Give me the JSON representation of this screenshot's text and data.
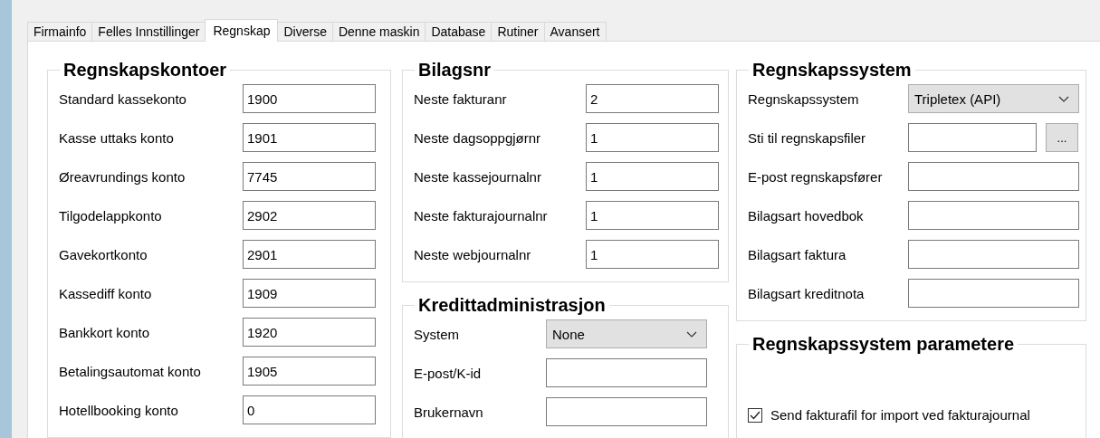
{
  "tabs": [
    {
      "label": "Firmainfo",
      "selected": false
    },
    {
      "label": "Felles Innstillinger",
      "selected": false
    },
    {
      "label": "Regnskap",
      "selected": true
    },
    {
      "label": "Diverse",
      "selected": false
    },
    {
      "label": "Denne maskin",
      "selected": false
    },
    {
      "label": "Database",
      "selected": false
    },
    {
      "label": "Rutiner",
      "selected": false
    },
    {
      "label": "Avansert",
      "selected": false
    }
  ],
  "regnskapskontoer": {
    "title": "Regnskapskontoer",
    "fields": [
      {
        "kind": "text",
        "label": "Standard kassekonto",
        "value": "1900"
      },
      {
        "kind": "text",
        "label": "Kasse uttaks konto",
        "value": "1901"
      },
      {
        "kind": "text",
        "label": "Øreavrundings konto",
        "value": "7745"
      },
      {
        "kind": "text",
        "label": "Tilgodelappkonto",
        "value": "2902"
      },
      {
        "kind": "text",
        "label": "Gavekortkonto",
        "value": "2901"
      },
      {
        "kind": "text",
        "label": "Kassediff konto",
        "value": "1909"
      },
      {
        "kind": "text",
        "label": "Bankkort konto",
        "value": "1920"
      },
      {
        "kind": "text",
        "label": "Betalingsautomat konto",
        "value": "1905"
      },
      {
        "kind": "text",
        "label": "Hotellbooking konto",
        "value": "0"
      }
    ]
  },
  "bilagsnr": {
    "title": "Bilagsnr",
    "fields": [
      {
        "kind": "text",
        "label": "Neste fakturanr",
        "value": "2"
      },
      {
        "kind": "text",
        "label": "Neste dagsoppgjørnr",
        "value": "1"
      },
      {
        "kind": "text",
        "label": "Neste kassejournalnr",
        "value": "1"
      },
      {
        "kind": "text",
        "label": "Neste fakturajournalnr",
        "value": "1"
      },
      {
        "kind": "text",
        "label": "Neste webjournalnr",
        "value": "1"
      }
    ]
  },
  "kredittadministrasjon": {
    "title": "Kredittadministrasjon",
    "fields": [
      {
        "kind": "select",
        "label": "System",
        "value": "None"
      },
      {
        "kind": "text",
        "label": "E-post/K-id"
      },
      {
        "kind": "text",
        "label": "Brukernavn"
      }
    ]
  },
  "regnskapssystem": {
    "title": "Regnskapssystem",
    "fields": [
      {
        "kind": "select",
        "label": "Regnskapssystem",
        "value": "Tripletex (API)"
      },
      {
        "kind": "browse",
        "label": "Sti til regnskapsfiler",
        "button": "..."
      },
      {
        "kind": "text",
        "label": "E-post regnskapsfører"
      },
      {
        "kind": "text",
        "label": "Bilagsart hovedbok"
      },
      {
        "kind": "text",
        "label": "Bilagsart faktura"
      },
      {
        "kind": "text",
        "label": "Bilagsart kreditnota"
      }
    ]
  },
  "parametere": {
    "title": "Regnskapssystem parametere",
    "checkbox": {
      "label": "Send fakturafil for import ved fakturajournal",
      "checked": true
    }
  }
}
